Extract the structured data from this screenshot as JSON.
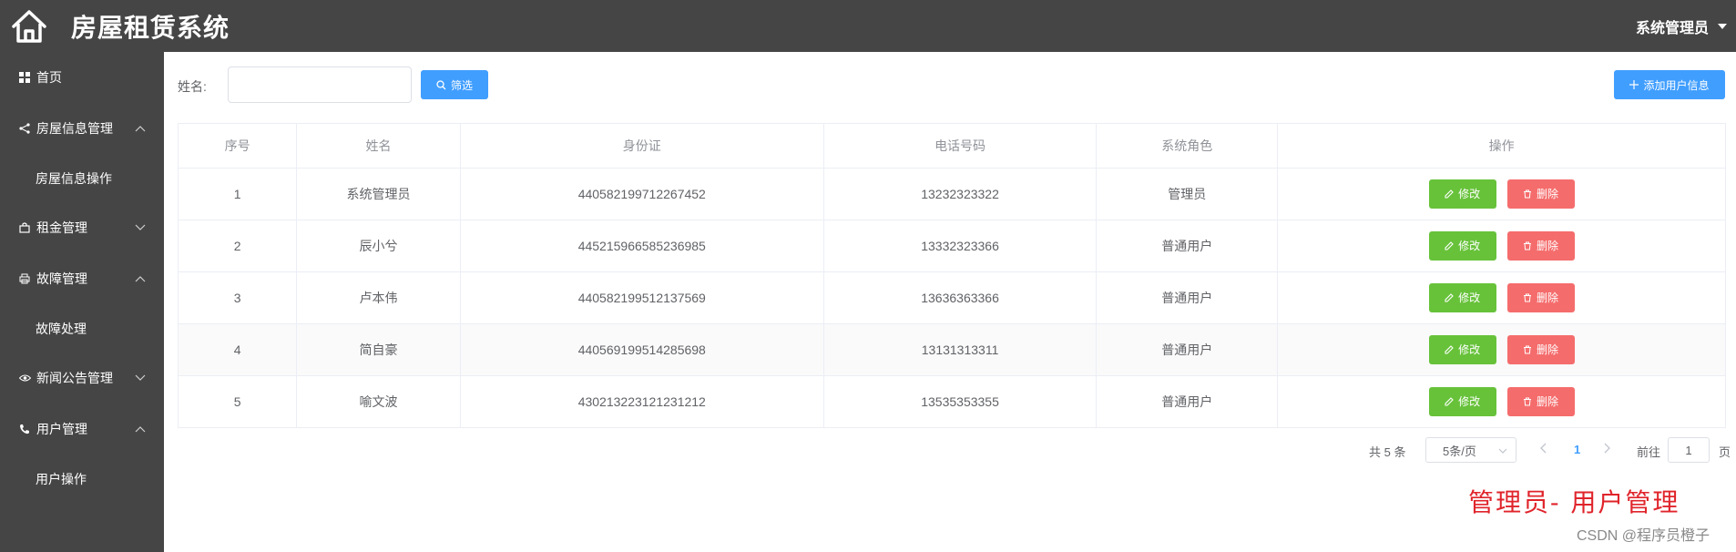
{
  "app": {
    "title": "房屋租赁系统",
    "logo_icon": "house-icon",
    "user_name": "系统管理员"
  },
  "sidebar": {
    "items": [
      {
        "label": "首页",
        "icon": "grid-icon"
      },
      {
        "label": "房屋信息管理",
        "icon": "share-icon",
        "expanded": true,
        "children": [
          "房屋信息操作"
        ]
      },
      {
        "label": "租金管理",
        "icon": "bag-icon",
        "expanded": false,
        "children": []
      },
      {
        "label": "故障管理",
        "icon": "printer-icon",
        "expanded": true,
        "children": [
          "故障处理"
        ]
      },
      {
        "label": "新闻公告管理",
        "icon": "eye-icon",
        "expanded": false,
        "children": []
      },
      {
        "label": "用户管理",
        "icon": "phone-icon",
        "expanded": true,
        "children": [
          "用户操作"
        ]
      }
    ]
  },
  "filter": {
    "name_label": "姓名:",
    "name_value": "",
    "search_label": "筛选",
    "add_label": "添加用户信息"
  },
  "table": {
    "columns": [
      "序号",
      "姓名",
      "身份证",
      "电话号码",
      "系统角色",
      "操作"
    ],
    "rows": [
      {
        "no": "1",
        "name": "系统管理员",
        "id_card": "440582199712267452",
        "phone": "13232323322",
        "role": "管理员"
      },
      {
        "no": "2",
        "name": "辰小兮",
        "id_card": "445215966585236985",
        "phone": "13332323366",
        "role": "普通用户"
      },
      {
        "no": "3",
        "name": "卢本伟",
        "id_card": "440582199512137569",
        "phone": "13636363366",
        "role": "普通用户"
      },
      {
        "no": "4",
        "name": "简自豪",
        "id_card": "440569199514285698",
        "phone": "13131313311",
        "role": "普通用户"
      },
      {
        "no": "5",
        "name": "喻文波",
        "id_card": "430213223121231212",
        "phone": "13535353355",
        "role": "普通用户"
      }
    ],
    "edit_label": "修改",
    "delete_label": "删除"
  },
  "pagination": {
    "total": "共 5 条",
    "page_size": "5条/页",
    "current_page": "1",
    "goto_label": "前往",
    "goto_value": "1",
    "page_unit": "页"
  },
  "overlay": {
    "caption": "管理员- 用户管理",
    "watermark": "CSDN @程序员橙子"
  },
  "colors": {
    "topbar": "#454545",
    "primary": "#409eff",
    "success": "#67c23a",
    "danger": "#f56c6c",
    "caption": "#e0242b"
  }
}
